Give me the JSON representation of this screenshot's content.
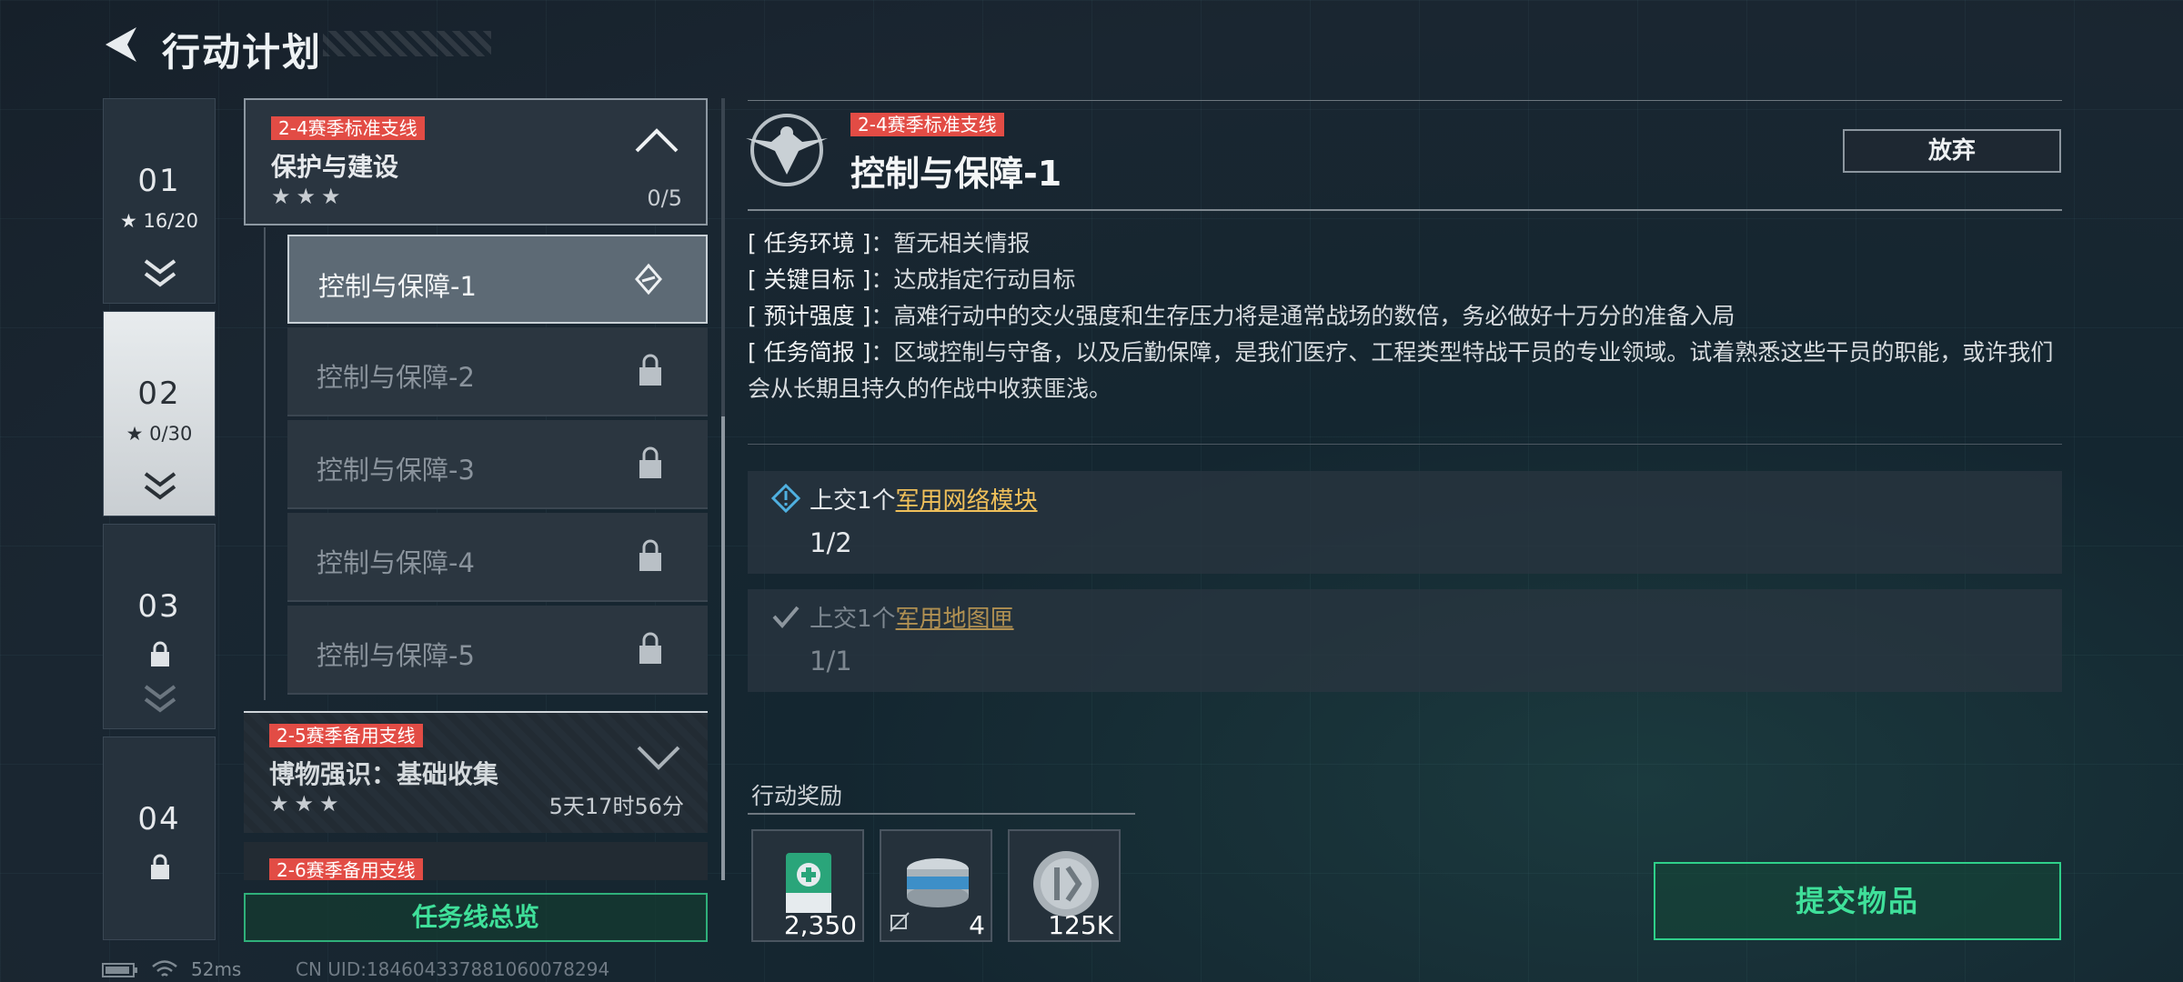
{
  "header": {
    "title": "行动计划"
  },
  "chapters": [
    {
      "num": "01",
      "stars": "★ 16/20",
      "locked": false
    },
    {
      "num": "02",
      "stars": "★ 0/30",
      "locked": false
    },
    {
      "num": "03",
      "locked": true
    },
    {
      "num": "04",
      "locked": true
    }
  ],
  "lines": [
    {
      "badge": "2-4赛季标准支线",
      "title": "保护与建设",
      "stars": "★★★",
      "progress": "0/5",
      "subs": [
        "控制与保障-1",
        "控制与保障-2",
        "控制与保障-3",
        "控制与保障-4",
        "控制与保障-5"
      ]
    },
    {
      "badge": "2-5赛季备用支线",
      "title": "博物强识：基础收集",
      "stars": "★★★",
      "timer": "5天17时56分"
    },
    {
      "badge": "2-6赛季备用支线"
    }
  ],
  "overview_button": "任务线总览",
  "detail": {
    "badge": "2-4赛季标准支线",
    "title": "控制与保障-1",
    "abandon": "放弃",
    "info": [
      {
        "key": "[ 任务环境 ]",
        "value": "：暂无相关情报"
      },
      {
        "key": "[ 关键目标 ]",
        "value": "：达成指定行动目标"
      },
      {
        "key": "[ 预计强度 ]",
        "value": "：高难行动中的交火强度和生存压力将是通常战场的数倍，务必做好十万分的准备入局"
      },
      {
        "key": "[ 任务简报 ]",
        "value": "：区域控制与守备，以及后勤保障，是我们医疗、工程类型特战干员的专业领域。试着熟悉这些干员的职能，或许我们会从长期且持久的作战中收获匪浅。"
      }
    ],
    "objectives": [
      {
        "prefix": "上交1个",
        "item": "军用网络模块",
        "count": "1/2",
        "done": false
      },
      {
        "prefix": "上交1个",
        "item": "军用地图匣",
        "count": "1/1",
        "done": true
      }
    ],
    "rewards_label": "行动奖励",
    "rewards": [
      {
        "icon": "medical-supply-icon",
        "count": "2,350"
      },
      {
        "icon": "canned-food-icon",
        "count": "4"
      },
      {
        "icon": "coin-icon",
        "count": "125K"
      }
    ],
    "submit": "提交物品"
  },
  "status_bar": {
    "ping": "52ms",
    "uid": "CN UID:184604337881060078294"
  }
}
